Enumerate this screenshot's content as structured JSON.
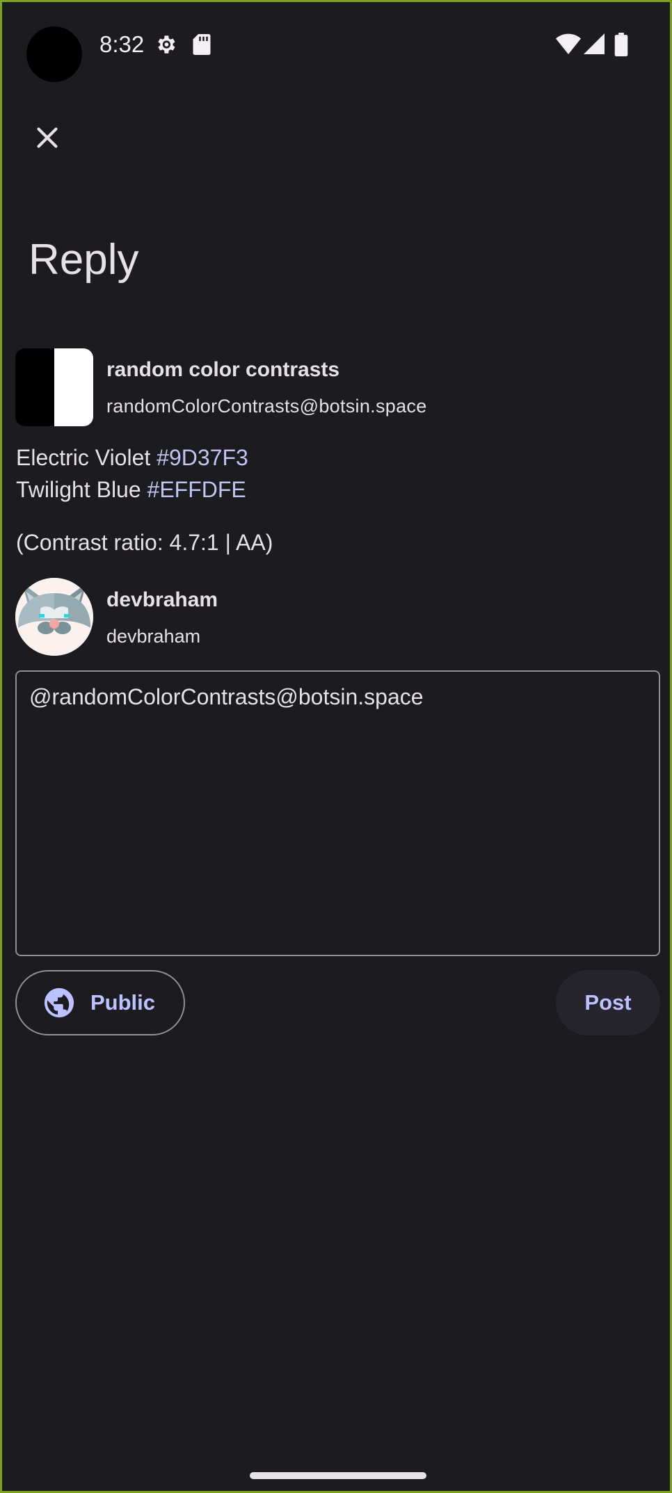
{
  "status_bar": {
    "time": "8:32",
    "icons": [
      "settings-icon",
      "sd-card-icon",
      "wifi-icon",
      "signal-icon",
      "battery-icon"
    ]
  },
  "header": {
    "close_icon": "close-icon",
    "title": "Reply"
  },
  "original_post": {
    "author_name": "random color contrasts",
    "author_handle": "randomColorContrasts@botsin.space",
    "line1_text": "Electric Violet ",
    "line1_hex": "#9D37F3",
    "line2_text": "Twilight Blue ",
    "line2_hex": "#EFFDFE",
    "ratio_text": "(Contrast ratio: 4.7:1 | AA)"
  },
  "current_user": {
    "name": "devbraham",
    "handle": "devbraham"
  },
  "compose": {
    "value": "@randomColorContrasts@botsin.space"
  },
  "actions": {
    "visibility_label": "Public",
    "post_label": "Post"
  },
  "colors": {
    "background": "#1c1b20",
    "accent": "#bcc2ff",
    "hex_link": "#c1c5f2",
    "outline": "#938f99"
  }
}
